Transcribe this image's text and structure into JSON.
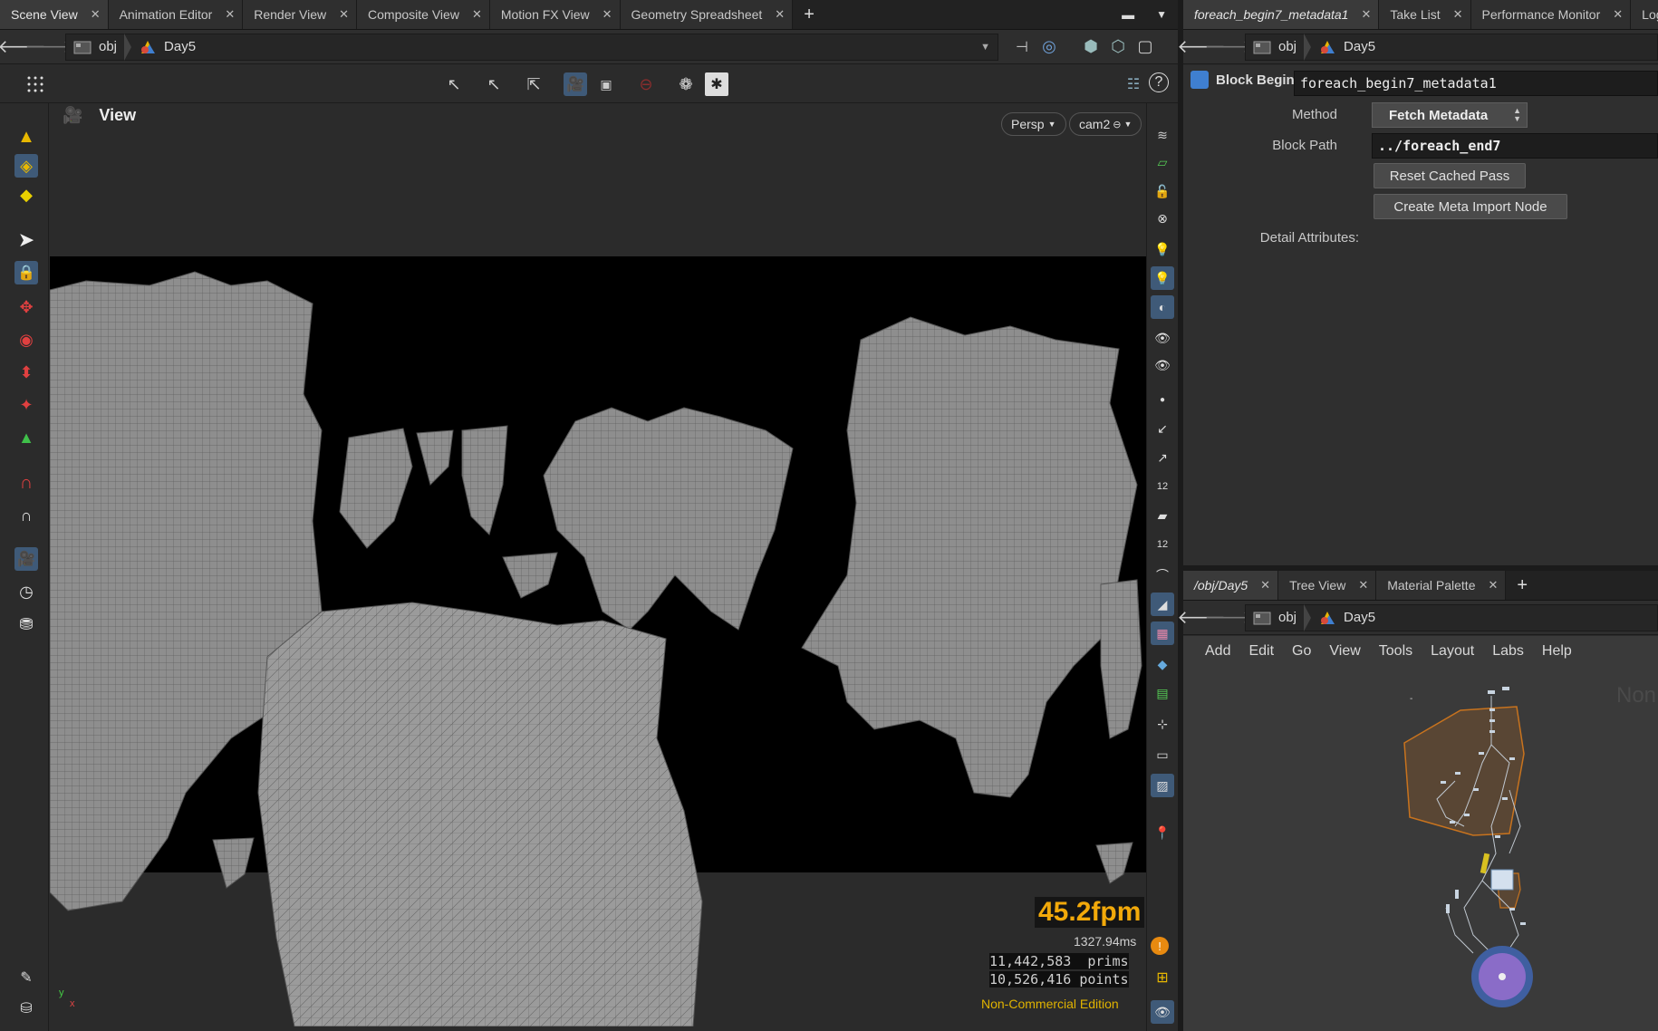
{
  "left_pane": {
    "tabs": [
      {
        "label": "Scene View",
        "active": true
      },
      {
        "label": "Animation Editor"
      },
      {
        "label": "Render View"
      },
      {
        "label": "Composite View"
      },
      {
        "label": "Motion FX View"
      },
      {
        "label": "Geometry Spreadsheet"
      }
    ],
    "path": [
      "obj",
      "Day5"
    ]
  },
  "viewport": {
    "title": "View",
    "camera_mode": "Persp",
    "camera_name": "cam2",
    "fps": "45.2fpm",
    "frame_time": "1327.94ms",
    "prims_count": "11,442,583",
    "prims_label": "prims",
    "points_count": "10,526,416",
    "points_label": "points",
    "edition": "Non-Commercial Edition",
    "axis_y": "y",
    "axis_x": "x"
  },
  "right_top": {
    "tabs": [
      {
        "label": "foreach_begin7_metadata1",
        "active": true,
        "italic": true
      },
      {
        "label": "Take List"
      },
      {
        "label": "Performance Monitor"
      },
      {
        "label": "Log Vie"
      }
    ],
    "path": [
      "obj",
      "Day5"
    ],
    "node_type": "Block Begin",
    "node_name": "foreach_begin7_metadata1",
    "method_label": "Method",
    "method_value": "Fetch Metadata",
    "block_path_label": "Block Path",
    "block_path_value": "../foreach_end7",
    "reset_button": "Reset Cached Pass",
    "create_button": "Create Meta Import Node",
    "detail_label": "Detail Attributes:"
  },
  "right_bottom": {
    "tabs": [
      {
        "label": "/obj/Day5",
        "active": true,
        "italic": true
      },
      {
        "label": "Tree View"
      },
      {
        "label": "Material Palette"
      }
    ],
    "path": [
      "obj",
      "Day5"
    ],
    "menu": [
      "Add",
      "Edit",
      "Go",
      "View",
      "Tools",
      "Layout",
      "Labs",
      "Help"
    ],
    "watermark": "Non"
  },
  "colors": {
    "accent_selected": "#3f5a78",
    "fps": "#f2a90a",
    "edition": "#e0b300",
    "network_box": "#c8731e",
    "network_dot": "#8a6cc8"
  }
}
